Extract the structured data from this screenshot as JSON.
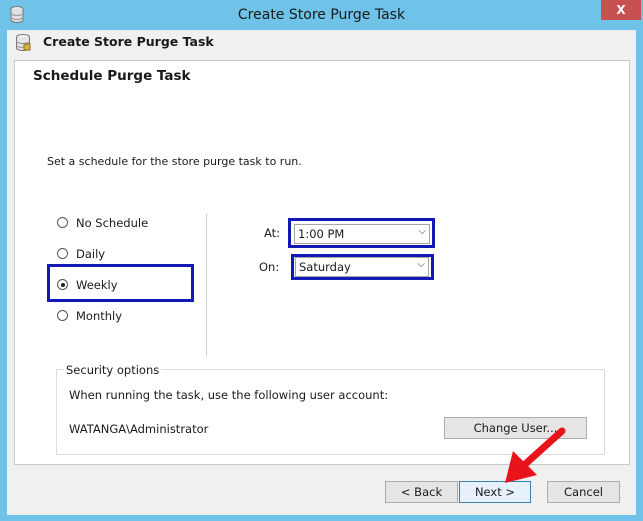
{
  "window": {
    "title": "Create Store Purge Task",
    "close_glyph": "X"
  },
  "wizard_header": {
    "title": "Create Store Purge Task",
    "icon": "database-icon"
  },
  "page": {
    "title": "Schedule Purge Task",
    "description": "Set a schedule for the store purge task to run."
  },
  "schedule": {
    "options": [
      {
        "label": "No Schedule",
        "selected": false
      },
      {
        "label": "Daily",
        "selected": false
      },
      {
        "label": "Weekly",
        "selected": true
      },
      {
        "label": "Monthly",
        "selected": false
      }
    ],
    "at_label": "At:",
    "at_value": "1:00 PM",
    "on_label": "On:",
    "on_value": "Saturday"
  },
  "security": {
    "title": "Security options",
    "description": "When running the task, use the following user account:",
    "user": "WATANGA\\Administrator",
    "change_user_label": "Change User..."
  },
  "buttons": {
    "back": "< Back",
    "next": "Next >",
    "cancel": "Cancel"
  },
  "colors": {
    "highlight": "#1318b6",
    "arrow": "#e8141c",
    "frame": "#6fc2e8"
  }
}
